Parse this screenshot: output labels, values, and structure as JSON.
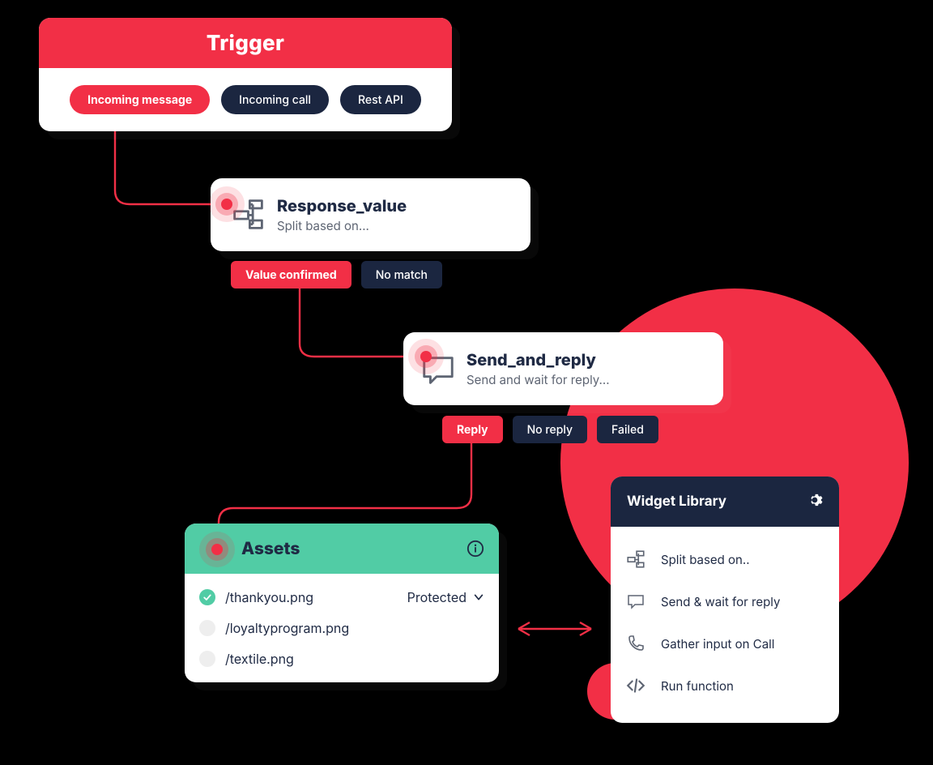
{
  "trigger": {
    "title": "Trigger",
    "options": [
      "Incoming message",
      "Incoming call",
      "Rest API"
    ],
    "active_index": 0
  },
  "response": {
    "title": "Response_value",
    "subtitle": "Split based on...",
    "options": [
      "Value confirmed",
      "No match"
    ],
    "active_index": 0
  },
  "send": {
    "title": "Send_and_reply",
    "subtitle": "Send and wait for reply...",
    "options": [
      "Reply",
      "No reply",
      "Failed"
    ],
    "active_index": 0
  },
  "assets": {
    "title": "Assets",
    "items": [
      {
        "name": "/thankyou.png",
        "status": "Protected",
        "checked": true
      },
      {
        "name": "/loyaltyprogram.png",
        "status": "",
        "checked": false
      },
      {
        "name": "/textile.png",
        "status": "",
        "checked": false
      }
    ]
  },
  "widget_library": {
    "title": "Widget Library",
    "items": [
      {
        "icon": "split",
        "label": "Split based on.."
      },
      {
        "icon": "chat",
        "label": "Send & wait for reply"
      },
      {
        "icon": "phone",
        "label": "Gather input on Call"
      },
      {
        "icon": "code",
        "label": "Run function"
      }
    ]
  }
}
